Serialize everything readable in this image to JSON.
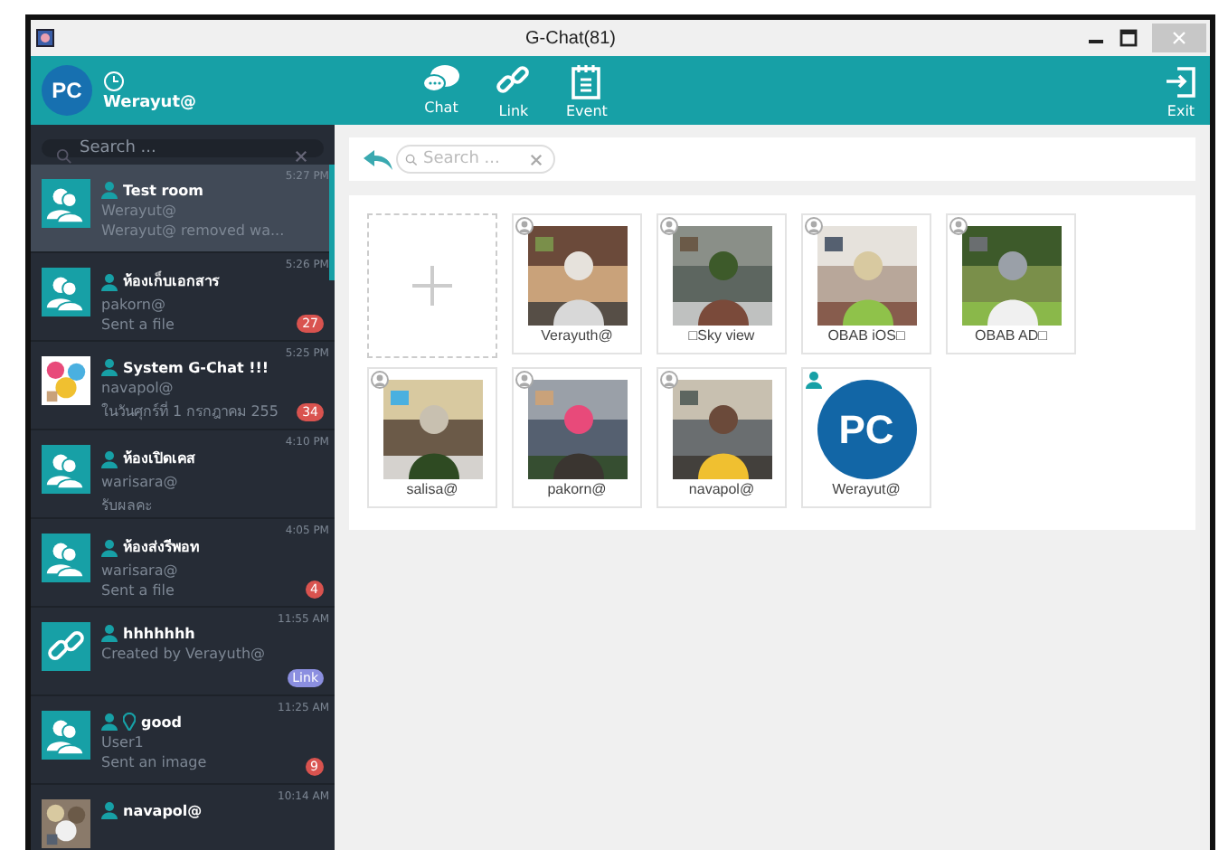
{
  "window": {
    "title": "G-Chat(81)"
  },
  "header": {
    "logo": "PC",
    "user": "Werayut@",
    "nav": [
      {
        "label": "Chat",
        "kind": "chat"
      },
      {
        "label": "Link",
        "kind": "link"
      },
      {
        "label": "Event",
        "kind": "event"
      }
    ],
    "exit": "Exit"
  },
  "sidebar": {
    "search": {
      "placeholder": "Search ..."
    },
    "rooms": [
      {
        "name": "Test room",
        "line1": "Werayut@",
        "line2": "Werayut@ removed wa...",
        "time": "5:27 PM",
        "kind": "group",
        "pinned": false,
        "selected": true
      },
      {
        "name": "ห้องเก็บเอกสาร",
        "line1": "pakorn@",
        "line2": "Sent a file",
        "time": "5:26 PM",
        "kind": "group",
        "pinned": false,
        "selected": false,
        "badge": {
          "kind": "count",
          "text": "27"
        }
      },
      {
        "name": "System G-Chat !!!",
        "line1": "navapol@",
        "line2": "ในวันศุกร์ที่ 1 กรกฎาคม 255",
        "time": "5:25 PM",
        "kind": "picture",
        "pinned": false,
        "selected": false,
        "badge": {
          "kind": "count",
          "text": "34"
        }
      },
      {
        "name": "ห้องเปิดเคส",
        "line1": "warisara@",
        "line2": "รับผลคะ",
        "time": "4:10 PM",
        "kind": "group",
        "pinned": false,
        "selected": false
      },
      {
        "name": "ห้องส่งรีพอท",
        "line1": "warisara@",
        "line2": "Sent a file",
        "time": "4:05 PM",
        "kind": "group",
        "pinned": false,
        "selected": false,
        "badge": {
          "kind": "count",
          "text": "4"
        }
      },
      {
        "name": "hhhhhhh",
        "line1": "Created by Verayuth@",
        "time": "11:55 AM",
        "kind": "link",
        "pinned": false,
        "selected": false,
        "badge": {
          "kind": "tag",
          "text": "Link"
        }
      },
      {
        "name": "good",
        "line1": "User1",
        "line2": "Sent an image",
        "time": "11:25 AM",
        "kind": "group",
        "pinned": true,
        "selected": false,
        "badge": {
          "kind": "count",
          "text": "9"
        }
      },
      {
        "name": "navapol@",
        "time": "10:14 AM",
        "kind": "picture",
        "pinned": false,
        "selected": false
      }
    ]
  },
  "members": {
    "search": {
      "placeholder": "Search ..."
    },
    "list": [
      {
        "name": "Verayuth@",
        "kind": "member"
      },
      {
        "name": "□Sky view",
        "kind": "member"
      },
      {
        "name": "OBAB iOS□",
        "kind": "member"
      },
      {
        "name": "OBAB AD□",
        "kind": "member"
      },
      {
        "name": "salisa@",
        "kind": "member"
      },
      {
        "name": "pakorn@",
        "kind": "member"
      },
      {
        "name": "navapol@",
        "kind": "member"
      },
      {
        "name": "Werayut@",
        "kind": "owner",
        "logo": "PC"
      }
    ]
  }
}
